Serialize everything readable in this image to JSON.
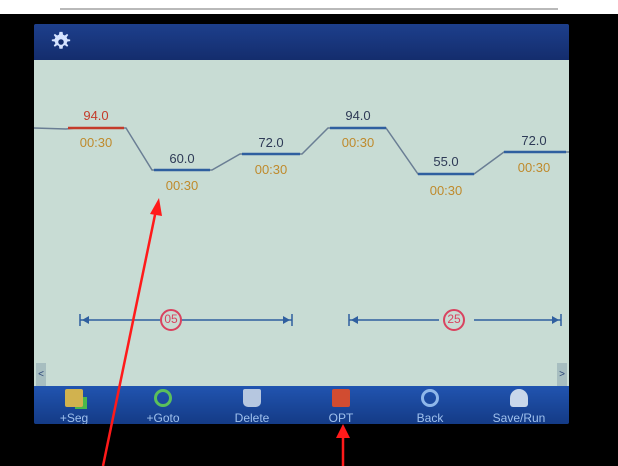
{
  "segments": [
    {
      "temp": "94.0",
      "time": "00:30"
    },
    {
      "temp": "60.0",
      "time": "00:30"
    },
    {
      "temp": "72.0",
      "time": "00:30"
    },
    {
      "temp": "94.0",
      "time": "00:30"
    },
    {
      "temp": "55.0",
      "time": "00:30"
    },
    {
      "temp": "72.0",
      "time": "00:30"
    }
  ],
  "cycles": [
    {
      "count": "05"
    },
    {
      "count": "25"
    }
  ],
  "toolbar": [
    "+Seg",
    "+Goto",
    "Delete",
    "OPT",
    "Back",
    "Save/Run"
  ],
  "colors": {
    "accent": "#1f4e9c",
    "annotation": "#ff1a1a",
    "first_step": "#c43b2a"
  },
  "icons": {
    "settings": "gear-icon",
    "scroll_left": "chevron-left-icon",
    "scroll_right": "chevron-right-icon"
  }
}
